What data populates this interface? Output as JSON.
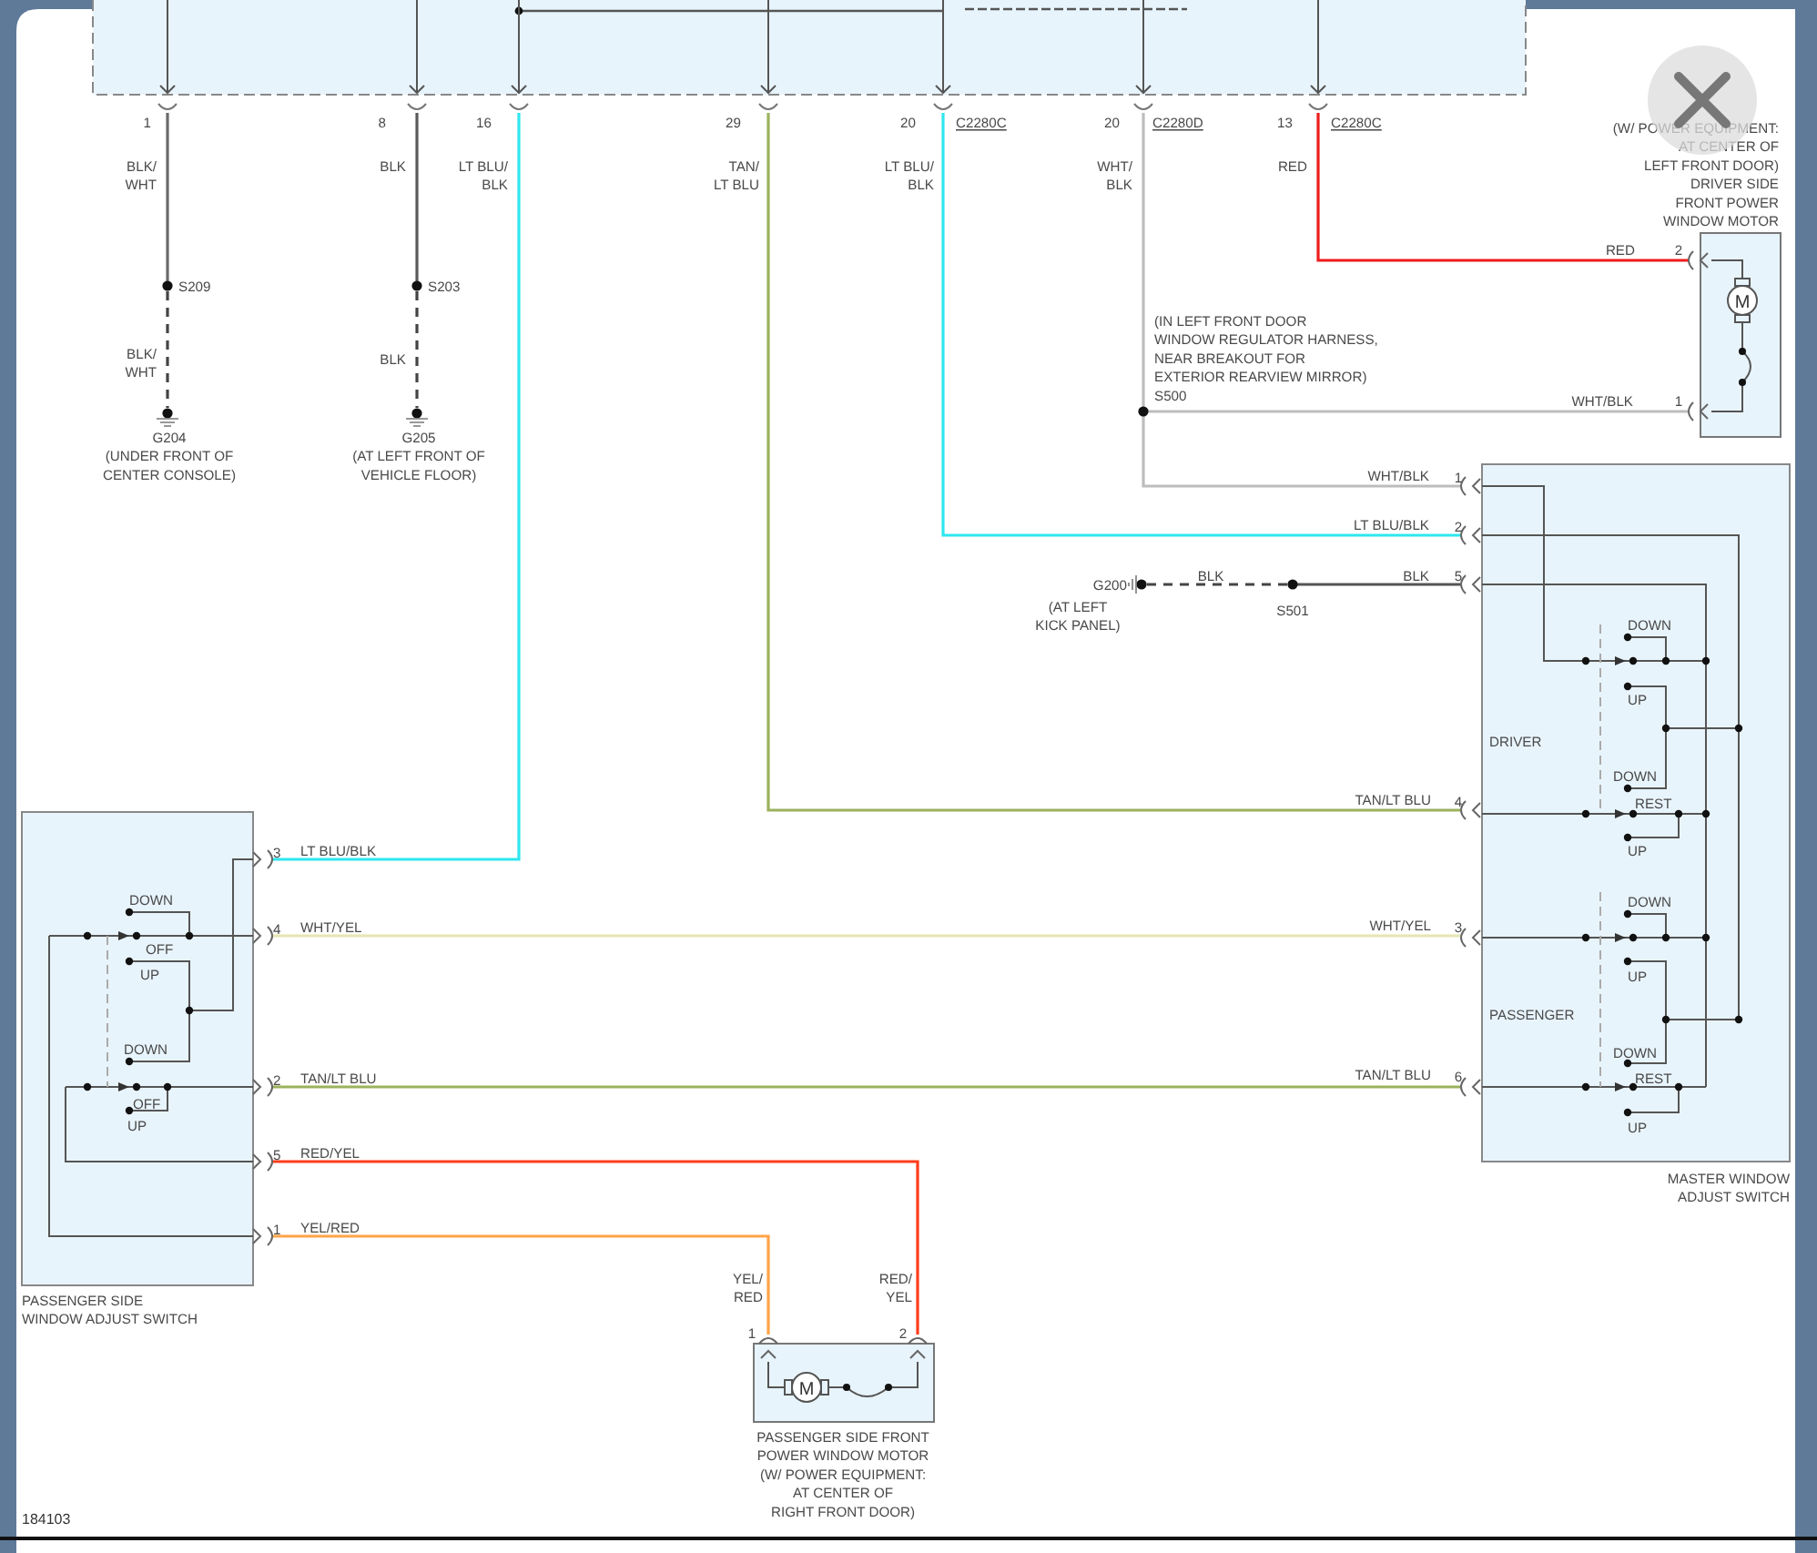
{
  "viewer": {
    "footer_id": "184103"
  },
  "module_connector": {
    "pins": [
      "1",
      "8",
      "16",
      "29",
      "20",
      "20",
      "13"
    ],
    "connector_ids": [
      "C2280C",
      "C2280D",
      "C2280C"
    ]
  },
  "wires": [
    {
      "color": "#6b6b6b"
    },
    {
      "color": "#5a5a5a"
    },
    {
      "color": "#2ee6f0"
    },
    {
      "color": "#9cb25c"
    },
    {
      "color": "#2ee6f0"
    },
    {
      "color": "#bdbdbd"
    },
    {
      "color": "#ee1c1c"
    },
    {
      "color": "#555555"
    },
    {
      "color": "#e6e6b4"
    },
    {
      "color": "#9cb25c"
    },
    {
      "color": "#ff3d1a"
    },
    {
      "color": "#ffa347"
    }
  ],
  "wire_labels": [
    "BLK/\nWHT",
    "BLK/\nWHT",
    "BLK",
    "BLK",
    "LT BLU/\nBLK",
    "TAN/\nLT BLU",
    "LT BLU/\nBLK",
    "WHT/\nBLK",
    "RED",
    "RED",
    "WHT/BLK",
    "WHT/BLK",
    "LT BLU/BLK",
    "BLK",
    "BLK",
    "TAN/LT BLU",
    "LT BLU/BLK",
    "WHT/YEL",
    "WHT/YEL",
    "TAN/LT BLU",
    "TAN/LT BLU",
    "RED/YEL",
    "YEL/RED",
    "YEL/\nRED",
    "RED/\nYEL"
  ],
  "pin_numbers": [
    "2",
    "1",
    "1",
    "2",
    "5",
    "4",
    "3",
    "6",
    "3",
    "4",
    "2",
    "5",
    "1",
    "1",
    "2"
  ],
  "splices": [
    "S209",
    "S203",
    "S500",
    "S501"
  ],
  "component_labels": [
    "G204\n(UNDER FRONT OF\nCENTER CONSOLE)",
    "G205\n(AT LEFT FRONT OF\nVEHICLE FLOOR)",
    "(IN LEFT FRONT DOOR\nWINDOW REGULATOR HARNESS,\nNEAR BREAKOUT FOR\nEXTERIOR REARVIEW MIRROR)",
    "(W/ POWER EQUIPMENT:\nAT CENTER OF\nLEFT FRONT DOOR)\nDRIVER SIDE\nFRONT POWER\nWINDOW MOTOR",
    "G200",
    "(AT LEFT\nKICK PANEL)",
    "MASTER WINDOW\nADJUST SWITCH",
    "PASSENGER SIDE\nWINDOW ADJUST SWITCH",
    "PASSENGER SIDE FRONT\nPOWER WINDOW MOTOR\n(W/ POWER EQUIPMENT:\nAT CENTER OF\nRIGHT FRONT DOOR)"
  ],
  "switch_labels": [
    "DOWN",
    "UP",
    "DRIVER",
    "DOWN",
    "REST",
    "UP",
    "DOWN",
    "UP",
    "PASSENGER",
    "DOWN",
    "REST",
    "UP",
    "DOWN",
    "OFF",
    "UP",
    "DOWN",
    "OFF",
    "UP"
  ],
  "motor_symbols": [
    "M",
    "M"
  ]
}
